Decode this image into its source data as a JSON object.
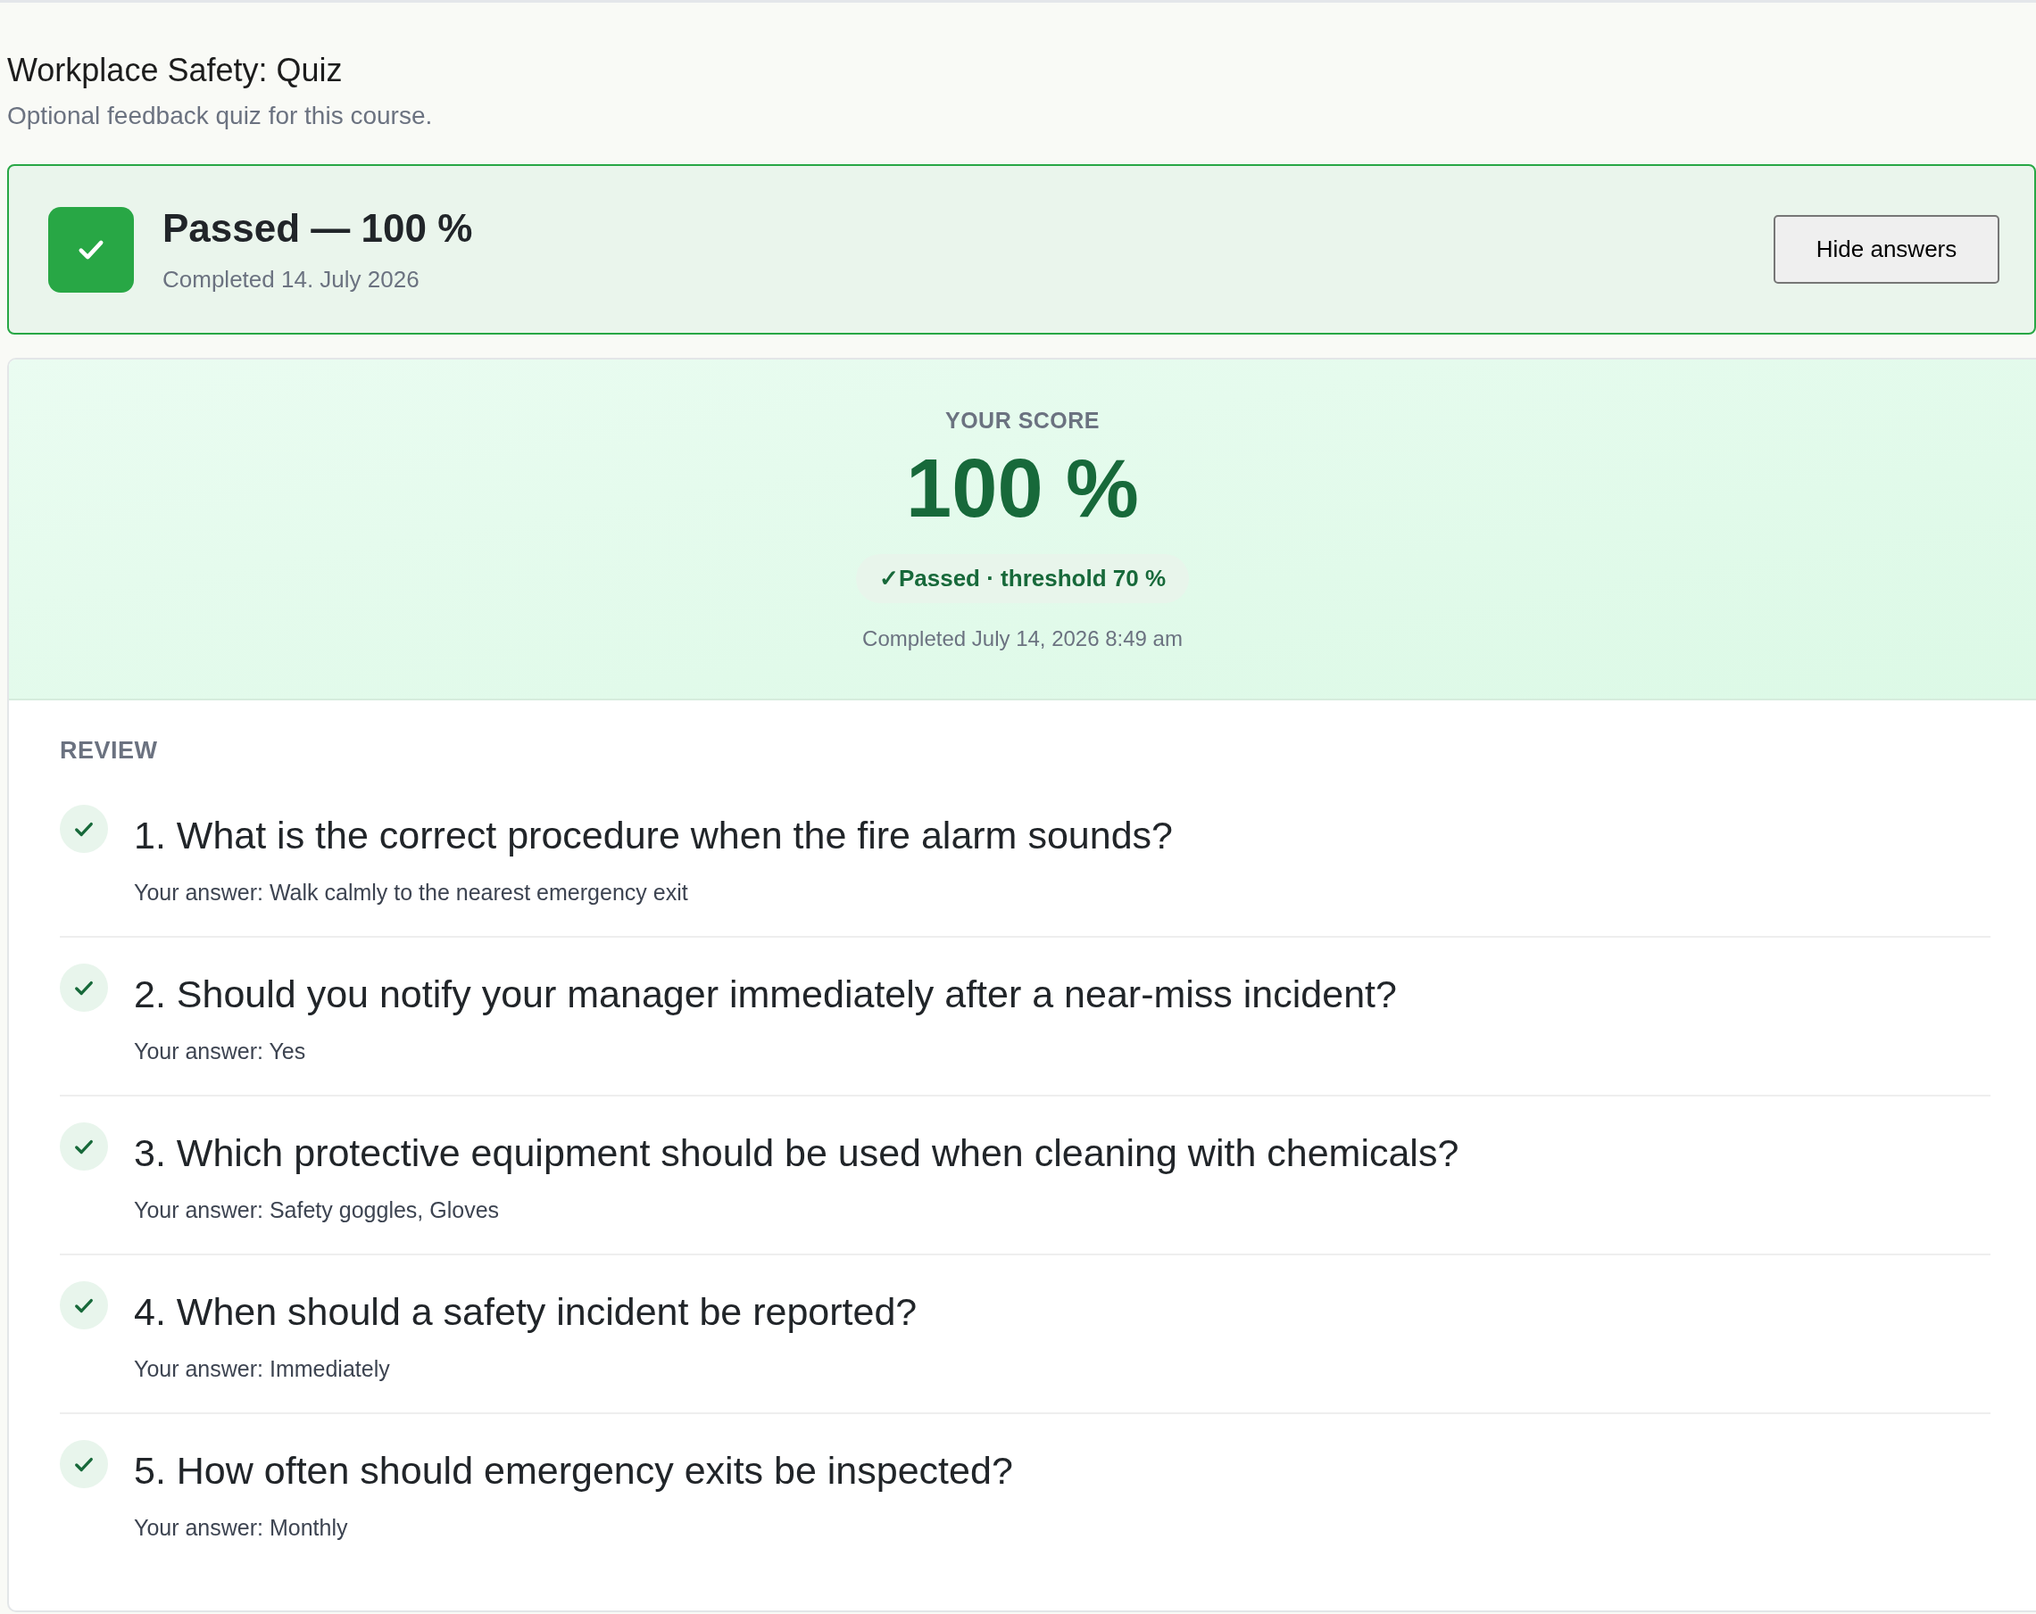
{
  "page": {
    "title": "Workplace Safety: Quiz",
    "subtitle": "Optional feedback quiz for this course."
  },
  "result_banner": {
    "passed": true,
    "title": "Passed — 100 %",
    "completed": "Completed 14. July 2026",
    "button": "Hide answers"
  },
  "score_card": {
    "label": "YOUR SCORE",
    "score": "100 %",
    "badge": "✓Passed · threshold 70 %",
    "completed": "Completed July 14, 2026 8:49 am"
  },
  "review": {
    "heading": "REVIEW",
    "questions": [
      {
        "question": "1. What is the correct procedure when the fire alarm sounds?",
        "answer": "Your answer: Walk calmly to the nearest emergency exit",
        "correct": true
      },
      {
        "question": "2. Should you notify your manager immediately after a near-miss incident?",
        "answer": "Your answer: Yes",
        "correct": true
      },
      {
        "question": "3. Which protective equipment should be used when cleaning with chemicals?",
        "answer": "Your answer: Safety goggles, Gloves",
        "correct": true
      },
      {
        "question": "4. When should a safety incident be reported?",
        "answer": "Your answer: Immediately",
        "correct": true
      },
      {
        "question": "5. How often should emergency exits be inspected?",
        "answer": "Your answer: Monthly",
        "correct": true
      }
    ]
  }
}
